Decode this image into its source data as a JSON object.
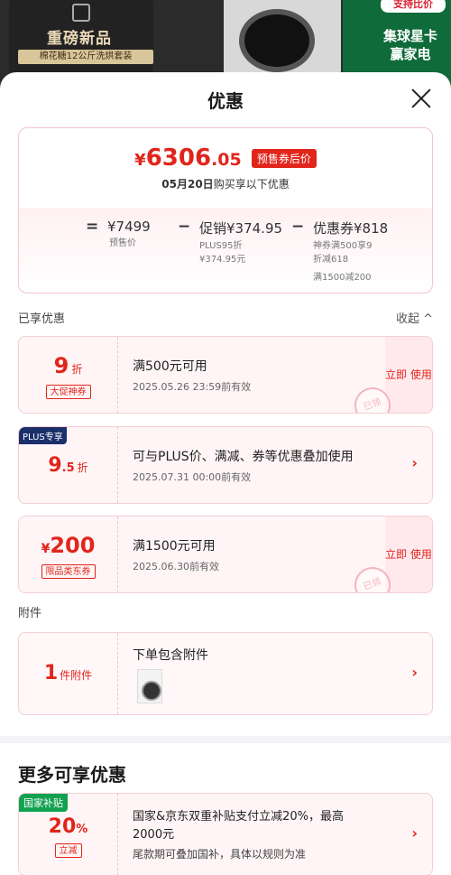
{
  "background": {
    "promo_left_title": "重磅新品",
    "promo_left_sub": "棉花糖12公斤洗烘套装",
    "promo_right_top": "支持比价",
    "promo_right_main": "集球星卡 赢家电"
  },
  "sheet": {
    "title": "优惠"
  },
  "summary": {
    "price_symbol": "¥",
    "price_int": "6306",
    "price_cents": ".05",
    "price_tag": "预售券后价",
    "note_date": "05月20日",
    "note_text": "购买享以下优惠",
    "eq": "=",
    "minus1": "−",
    "minus2": "−",
    "presale_price": "¥7499",
    "presale_label": "预售价",
    "promo_main": "促销¥374.95",
    "promo_sub1": "PLUS95折",
    "promo_sub2": "¥374.95元",
    "coupon_main": "优惠券¥818",
    "coupon_sub1": "神券满500享9",
    "coupon_sub2": "折减618",
    "coupon_sub3": "满1500减200"
  },
  "enjoyed": {
    "label": "已享优惠",
    "collapse": "收起 ^"
  },
  "coupons": [
    {
      "value": "9",
      "unit": "折",
      "stamp": "大促神券",
      "title": "满500元可用",
      "sub": "2025.05.26 23:59前有效",
      "action": "立即 使用",
      "used": "已领"
    },
    {
      "badge": "PLUS专享",
      "value": "9",
      "value_small": ".5",
      "unit": "折",
      "title": "可与PLUS价、满减、券等优惠叠加使用",
      "sub": "2025.07.31 00:00前有效",
      "chevron": "›"
    },
    {
      "symbol": "¥",
      "value": "200",
      "stamp": "限品类东券",
      "title": "满1500元可用",
      "sub": "2025.06.30前有效",
      "action": "立即 使用",
      "used": "已领"
    }
  ],
  "accessory": {
    "label": "附件",
    "count": "1",
    "count_unit": "件附件",
    "title": "下单包含附件",
    "chevron": "›"
  },
  "more": {
    "title": "更多可享优惠",
    "badge": "国家补贴",
    "value": "20",
    "unit": "%",
    "stamp": "立减",
    "line1": "国家&京东双重补贴支付立减20%，最高",
    "line2": "2000元",
    "line3": "尾款期可叠加国补，具体以规则为准",
    "chevron": "›"
  },
  "colors": {
    "accent": "#e1251b",
    "plus": "#1b2f6b",
    "gov": "#12a150"
  }
}
